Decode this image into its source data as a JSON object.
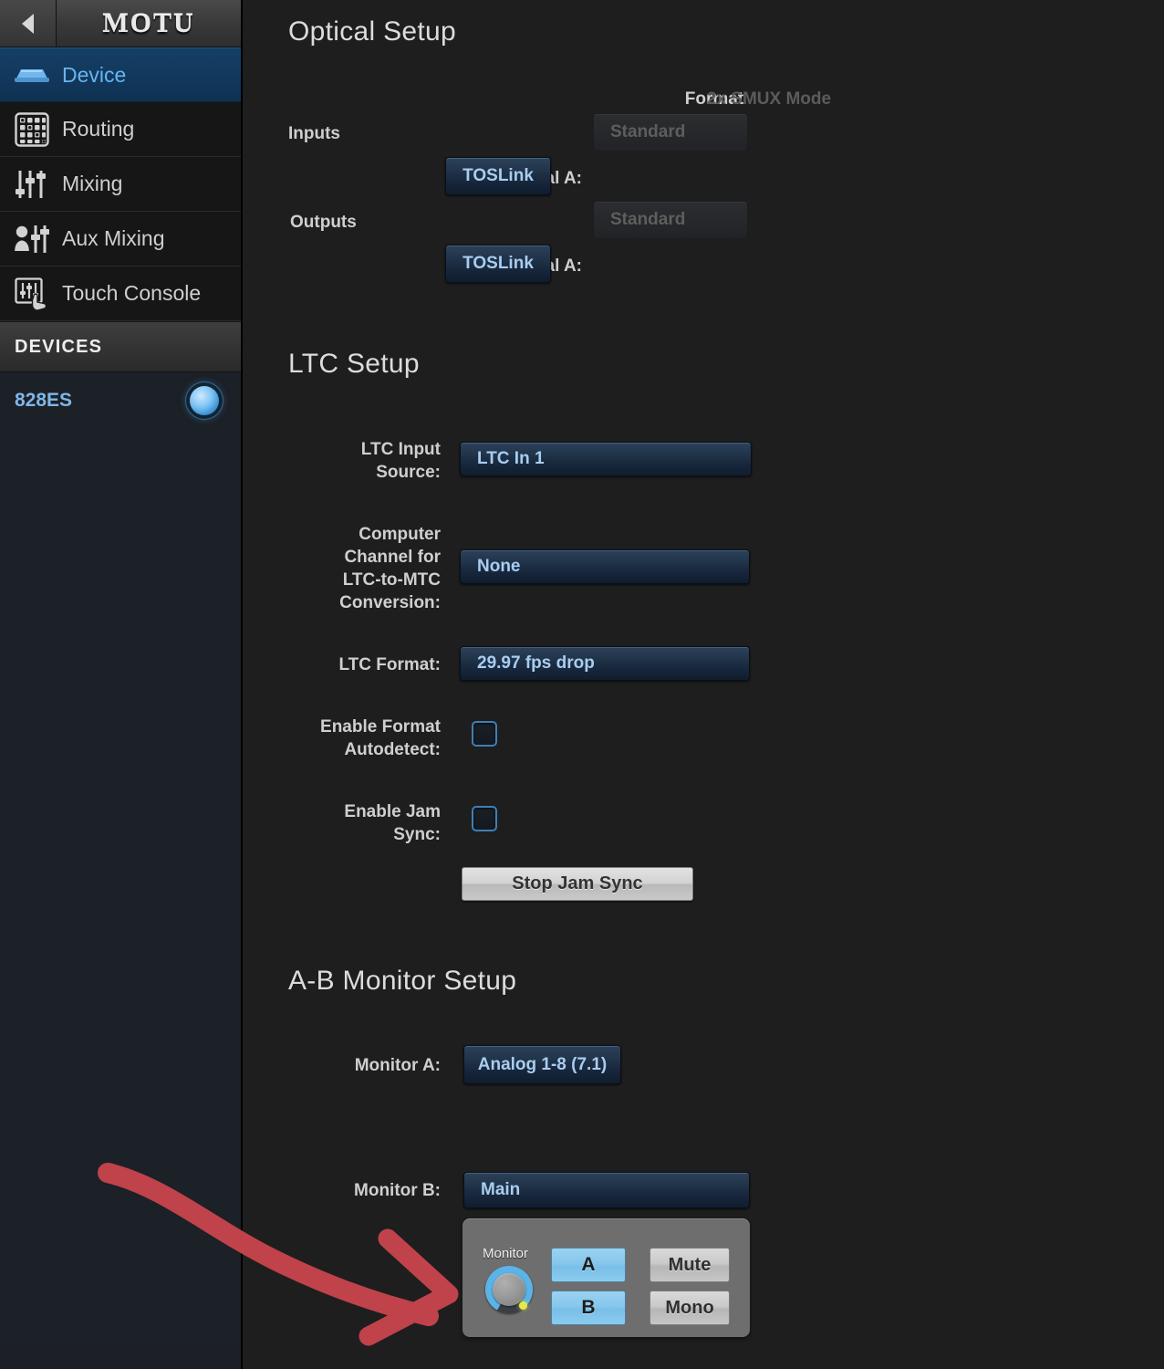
{
  "sidebar": {
    "back_icon": "left-triangle-icon",
    "brand": "MOTU",
    "nav": [
      {
        "label": "Device",
        "icon": "device-interface-icon",
        "active": true
      },
      {
        "label": "Routing",
        "icon": "routing-grid-icon",
        "active": false
      },
      {
        "label": "Mixing",
        "icon": "mixer-faders-icon",
        "active": false
      },
      {
        "label": "Aux Mixing",
        "icon": "aux-person-faders-icon",
        "active": false
      },
      {
        "label": "Touch Console",
        "icon": "touch-console-icon",
        "active": false
      }
    ],
    "devices_header": "DEVICES",
    "devices": [
      {
        "name": "828ES",
        "selected": true
      }
    ]
  },
  "main": {
    "optical": {
      "title": "Optical Setup",
      "col_format": "Format",
      "col_smux": "2x SMUX Mode",
      "inputs_label": "Inputs",
      "outputs_label": "Outputs",
      "input_optical_a_label": "Optical A:",
      "input_optical_a_value": "TOSLink",
      "input_smux_value": "Standard",
      "output_optical_a_label": "Optical A:",
      "output_optical_a_value": "TOSLink",
      "output_smux_value": "Standard"
    },
    "ltc": {
      "title": "LTC Setup",
      "input_source_label": "LTC Input\nSource:",
      "input_source_value": "LTC In 1",
      "computer_channel_label": "Computer\nChannel for\nLTC-to-MTC\nConversion:",
      "computer_channel_value": "None",
      "format_label": "LTC Format:",
      "format_value": "29.97 fps drop",
      "autodetect_label": "Enable Format\nAutodetect:",
      "autodetect_checked": false,
      "jamsync_label": "Enable Jam\nSync:",
      "jamsync_checked": false,
      "stop_jam_sync_label": "Stop Jam Sync"
    },
    "ab_monitor": {
      "title": "A-B Monitor Setup",
      "monitor_a_label": "Monitor A:",
      "monitor_a_value": "Analog 1-8 (7.1)",
      "monitor_b_label": "Monitor B:",
      "monitor_b_value": "Main",
      "pod": {
        "knob_label": "Monitor",
        "a_label": "A",
        "b_label": "B",
        "mute_label": "Mute",
        "mono_label": "Mono"
      }
    }
  },
  "annotation": {
    "type": "hand-drawn-arrow",
    "color": "#c0424a",
    "points_at": "monitor-control-pod"
  },
  "colors": {
    "background": "#1e1e1e",
    "sidebar_bg": "#1c2027",
    "accent_blue": "#66b5f0",
    "active_row": "#12385c",
    "popup_text": "#a8cdf0",
    "pod_bg": "#6e6e6e",
    "ab_button": "#86c7ec",
    "annotation_red": "#c0424a"
  }
}
